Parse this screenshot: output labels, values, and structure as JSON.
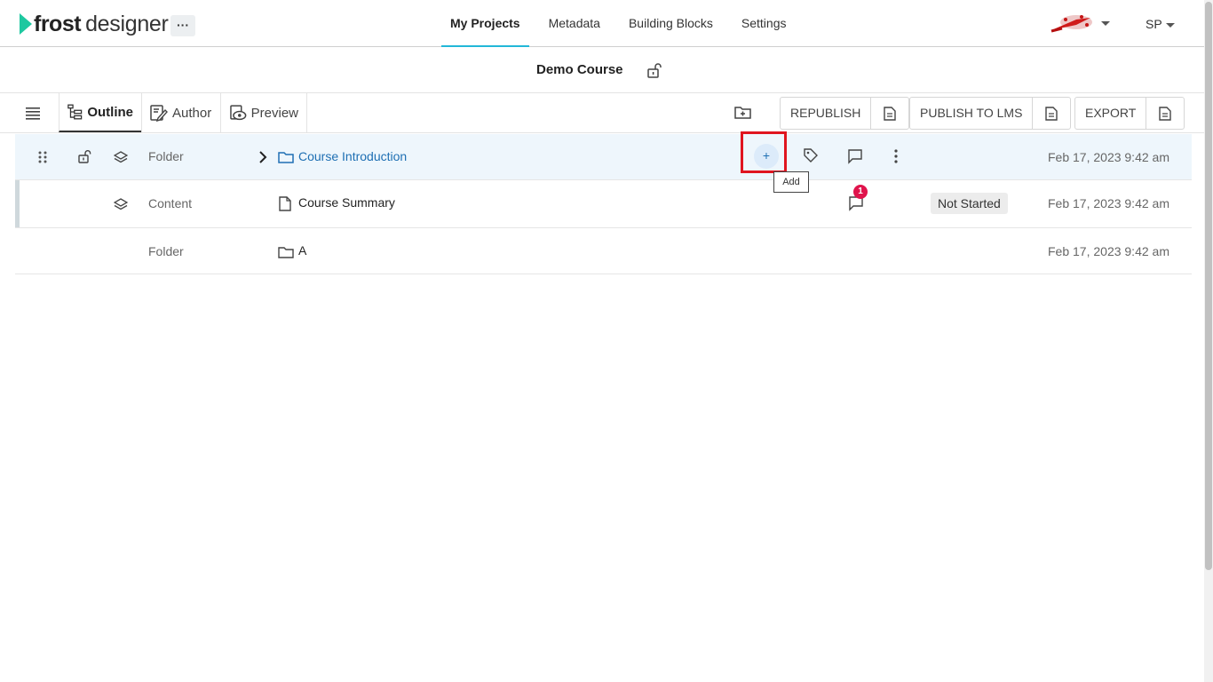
{
  "app": {
    "brand_primary": "frost",
    "brand_secondary": "designer",
    "more_label": "···",
    "accent": "#22b7d8",
    "logo_color": "#1ec8a0"
  },
  "nav": {
    "items": [
      {
        "label": "My Projects",
        "active": true
      },
      {
        "label": "Metadata",
        "active": false
      },
      {
        "label": "Building Blocks",
        "active": false
      },
      {
        "label": "Settings",
        "active": false
      }
    ],
    "user_initials": "SP"
  },
  "course": {
    "title": "Demo Course"
  },
  "toolbar": {
    "tabs": [
      {
        "label": "Outline",
        "icon": "outline-tree-icon",
        "active": true
      },
      {
        "label": "Author",
        "icon": "author-edit-icon",
        "active": false
      },
      {
        "label": "Preview",
        "icon": "preview-eye-icon",
        "active": false
      }
    ],
    "republish_label": "REPUBLISH",
    "publish_lms_label": "PUBLISH TO LMS",
    "export_label": "EXPORT"
  },
  "rows": [
    {
      "type": "Folder",
      "name": "Course Introduction",
      "date": "Feb 17, 2023 9:42 am",
      "selected": true
    },
    {
      "type": "Content",
      "name": "Course Summary",
      "date": "Feb 17, 2023 9:42 am",
      "status": "Not Started",
      "comment_count": "1"
    },
    {
      "type": "Folder",
      "name": "A",
      "date": "Feb 17, 2023 9:42 am"
    }
  ],
  "tooltip": {
    "add_label": "Add"
  }
}
